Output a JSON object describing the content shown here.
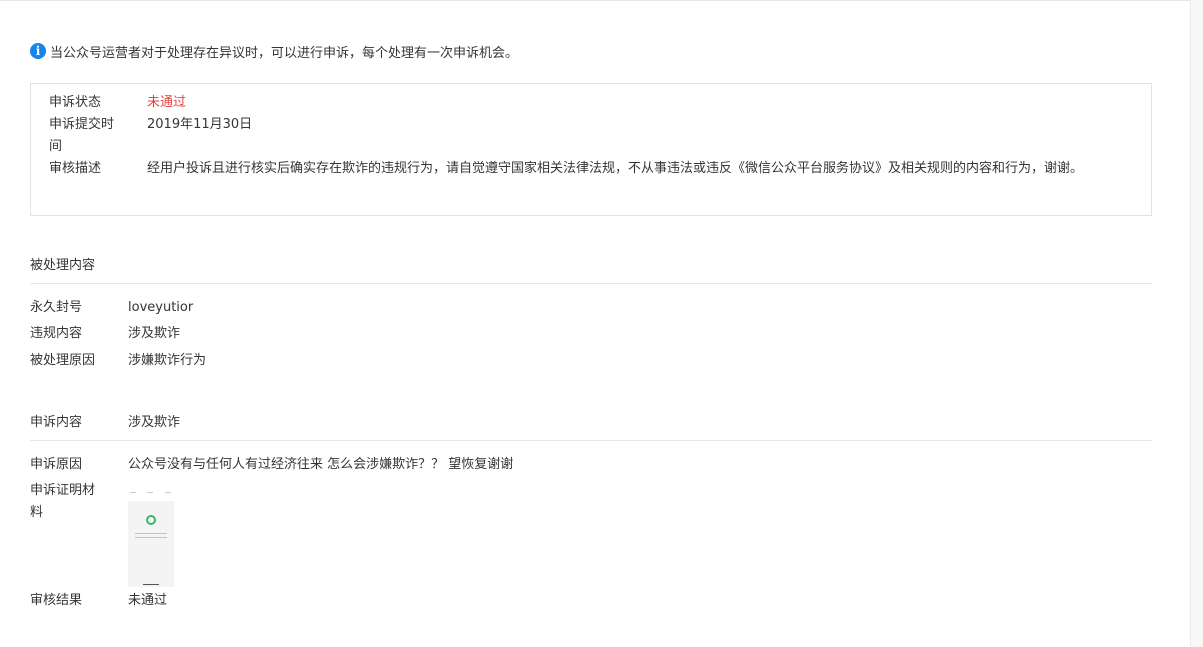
{
  "notice": {
    "icon": "info-icon",
    "text": "当公众号运营者对于处理存在异议时，可以进行申诉，每个处理有一次申诉机会。"
  },
  "appeal_status": {
    "status_label": "申诉状态",
    "status_value": "未通过",
    "submit_label": "申诉提交时间",
    "submit_value": "2019年11月30日",
    "review_label": "审核描述",
    "review_value": "经用户投诉且进行核实后确实存在欺诈的违规行为，请自觉遵守国家相关法律法规，不从事违法或违反《微信公众平台服务协议》及相关规则的内容和行为，谢谢。"
  },
  "handled": {
    "title": "被处理内容",
    "rows": [
      {
        "label": "永久封号",
        "value": "loveyutior"
      },
      {
        "label": "违规内容",
        "value": "涉及欺诈"
      },
      {
        "label": "被处理原因",
        "value": "涉嫌欺诈行为"
      }
    ]
  },
  "appeal": {
    "title": "申诉内容",
    "title_value": "涉及欺诈",
    "reason_label": "申诉原因",
    "reason_value": "公众号没有与任何人有过经济往来 怎么会涉嫌欺诈？？ 望恢复谢谢",
    "evidence_label": "申诉证明材料",
    "result_label": "审核结果",
    "result_value": "未通过"
  },
  "colors": {
    "accent_blue": "#1485ee",
    "status_red": "#e64340",
    "muted_grey": "#9a9a9a"
  }
}
